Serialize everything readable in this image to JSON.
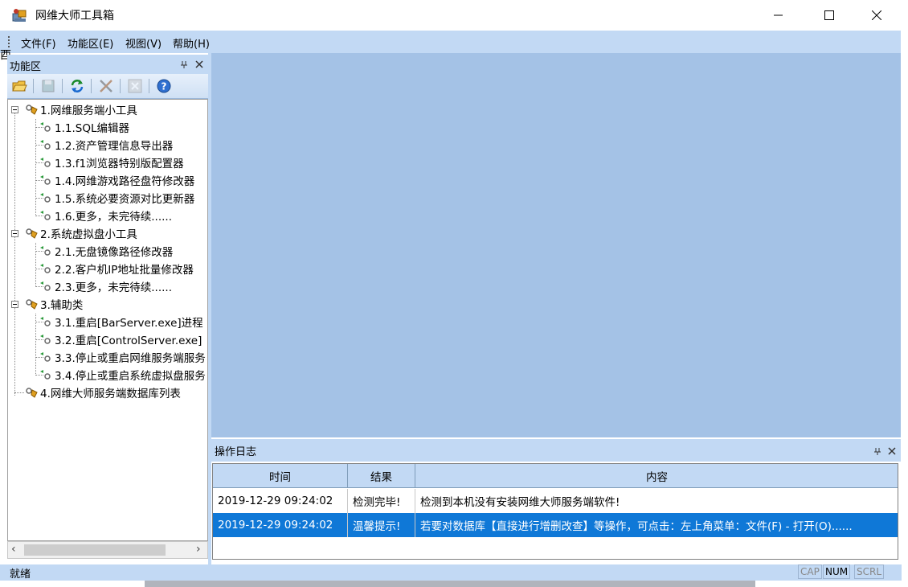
{
  "window": {
    "title": "网维大师工具箱",
    "min_glyph": "—",
    "max_glyph": "☐",
    "close_glyph": "✕"
  },
  "menu": [
    "文件(F)",
    "功能区(E)",
    "视图(V)",
    "帮助(H)"
  ],
  "left_panel": {
    "title": "功能区",
    "pin_glyph": "ᵖ",
    "close_glyph": "✕",
    "toolbar_icons": [
      "open-folder-icon",
      "disk-icon",
      "refresh-icon",
      "tools-icon",
      "delete-icon",
      "help-icon"
    ]
  },
  "tree": [
    {
      "label": "1.网维服务端小工具",
      "level": 0
    },
    {
      "label": "1.1.SQL编辑器",
      "level": 1
    },
    {
      "label": "1.2.资产管理信息导出器",
      "level": 1
    },
    {
      "label": "1.3.f1浏览器特别版配置器",
      "level": 1
    },
    {
      "label": "1.4.网维游戏路径盘符修改器",
      "level": 1
    },
    {
      "label": "1.5.系统必要资源对比更新器",
      "level": 1
    },
    {
      "label": "1.6.更多，未完待续......",
      "level": 1
    },
    {
      "label": "2.系统虚拟盘小工具",
      "level": 0
    },
    {
      "label": "2.1.无盘镜像路径修改器",
      "level": 1
    },
    {
      "label": "2.2.客户机IP地址批量修改器",
      "level": 1
    },
    {
      "label": "2.3.更多，未完待续......",
      "level": 1
    },
    {
      "label": "3.辅助类",
      "level": 0
    },
    {
      "label": "3.1.重启[BarServer.exe]进程",
      "level": 1
    },
    {
      "label": "3.2.重启[ControlServer.exe]",
      "level": 1
    },
    {
      "label": "3.3.停止或重启网维服务端服务",
      "level": 1
    },
    {
      "label": "3.4.停止或重启系统虚拟盘服务",
      "level": 1
    },
    {
      "label": "4.网维大师服务端数据库列表",
      "level": 0
    }
  ],
  "log": {
    "title": "操作日志",
    "columns": [
      "时间",
      "结果",
      "内容"
    ],
    "rows": [
      {
        "time": "2019-12-29 09:24:02",
        "result": "检测完毕!",
        "content": "检测到本机没有安装网维大师服务端软件!",
        "selected": false
      },
      {
        "time": "2019-12-29 09:24:02",
        "result": "温馨提示!",
        "content": "若要对数据库【直接进行增删改查】等操作，可点击：左上角菜单：文件(F) - 打开(O)......",
        "selected": true
      }
    ]
  },
  "status": {
    "text": "就绪",
    "indicators": [
      {
        "label": "CAP",
        "on": false
      },
      {
        "label": "NUM",
        "on": true
      },
      {
        "label": "SCRL",
        "on": false
      }
    ]
  },
  "stray_text": "酉",
  "colors": {
    "panel_blue": "#c2d9f4",
    "mdi_blue": "#a4c2e6",
    "selection": "#0f78d7"
  }
}
